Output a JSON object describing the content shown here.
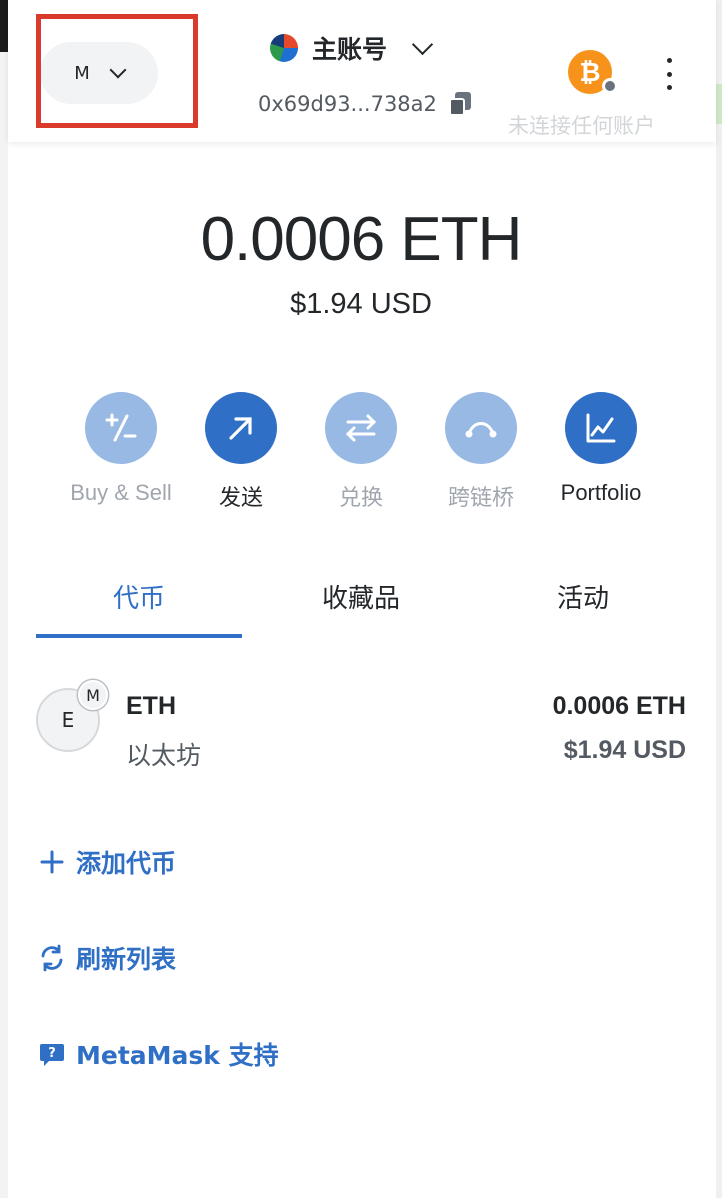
{
  "header": {
    "network_letter": "M",
    "account_name": "主账号",
    "address": "0x69d93...738a2",
    "ghost_status": "未连接任何账户",
    "btc_symbol": "₿"
  },
  "balance": {
    "amount": "0.0006 ETH",
    "fiat": "$1.94 USD"
  },
  "actions": [
    {
      "label": "Buy & Sell",
      "icon": "buy-sell-icon",
      "enabled": false
    },
    {
      "label": "发送",
      "icon": "send-arrow-icon",
      "enabled": true
    },
    {
      "label": "兑换",
      "icon": "swap-icon",
      "enabled": false
    },
    {
      "label": "跨链桥",
      "icon": "bridge-icon",
      "enabled": false
    },
    {
      "label": "Portfolio",
      "icon": "portfolio-chart-icon",
      "enabled": true
    }
  ],
  "tabs": [
    {
      "label": "代币",
      "active": true
    },
    {
      "label": "收藏品",
      "active": false
    },
    {
      "label": "活动",
      "active": false
    }
  ],
  "tokens": [
    {
      "icon_letter": "E",
      "badge_letter": "M",
      "symbol": "ETH",
      "name": "以太坊",
      "amount": "0.0006 ETH",
      "fiat": "$1.94 USD"
    }
  ],
  "links": {
    "add_token": "添加代币",
    "refresh": "刷新列表",
    "support": "MetaMask 支持"
  },
  "colors": {
    "accent": "#2f6fc5",
    "accent_light": "#98b9e4",
    "highlight_border": "#d93a2c",
    "bitcoin": "#f7931a"
  }
}
